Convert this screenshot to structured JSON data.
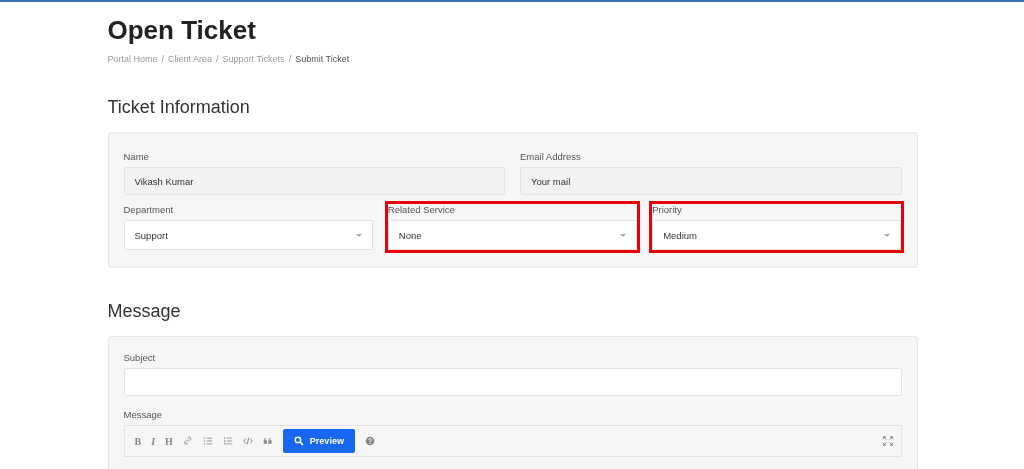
{
  "page": {
    "title": "Open Ticket"
  },
  "breadcrumb": [
    {
      "kind": "link",
      "label": "Portal Home"
    },
    {
      "kind": "separator",
      "label": "/"
    },
    {
      "kind": "link",
      "label": "Client Area"
    },
    {
      "kind": "separator",
      "label": "/"
    },
    {
      "kind": "link",
      "label": "Support Tickets"
    },
    {
      "kind": "separator",
      "label": "/"
    },
    {
      "kind": "current",
      "label": "Submit Ticket"
    }
  ],
  "ticket_information": {
    "heading": "Ticket Information",
    "rows": [
      [
        {
          "label": "Name",
          "kind": "text",
          "value": "Vikash Kumar",
          "disabled": true,
          "highlighted": false
        },
        {
          "label": "Email Address",
          "kind": "text",
          "value": "Your mail",
          "disabled": true,
          "highlighted": false
        }
      ],
      [
        {
          "label": "Department",
          "kind": "select",
          "value": "Support",
          "disabled": false,
          "highlighted": false
        },
        {
          "label": "Related Service",
          "kind": "select",
          "value": "None",
          "disabled": false,
          "highlighted": true
        },
        {
          "label": "Priority",
          "kind": "select",
          "value": "Medium",
          "disabled": false,
          "highlighted": true
        }
      ]
    ]
  },
  "message_section": {
    "heading": "Message",
    "subject": {
      "label": "Subject"
    },
    "message": {
      "label": "Message",
      "toolbar": [
        {
          "kind": "text",
          "label": "B"
        },
        {
          "kind": "text",
          "label": "I"
        },
        {
          "kind": "text",
          "label": "H"
        },
        {
          "kind": "link"
        },
        {
          "kind": "bullets"
        },
        {
          "kind": "numbers"
        },
        {
          "kind": "code"
        },
        {
          "kind": "quote"
        },
        {
          "kind": "preview",
          "label": "Preview"
        },
        {
          "kind": "help"
        },
        {
          "kind": "fullscreen"
        }
      ]
    }
  }
}
